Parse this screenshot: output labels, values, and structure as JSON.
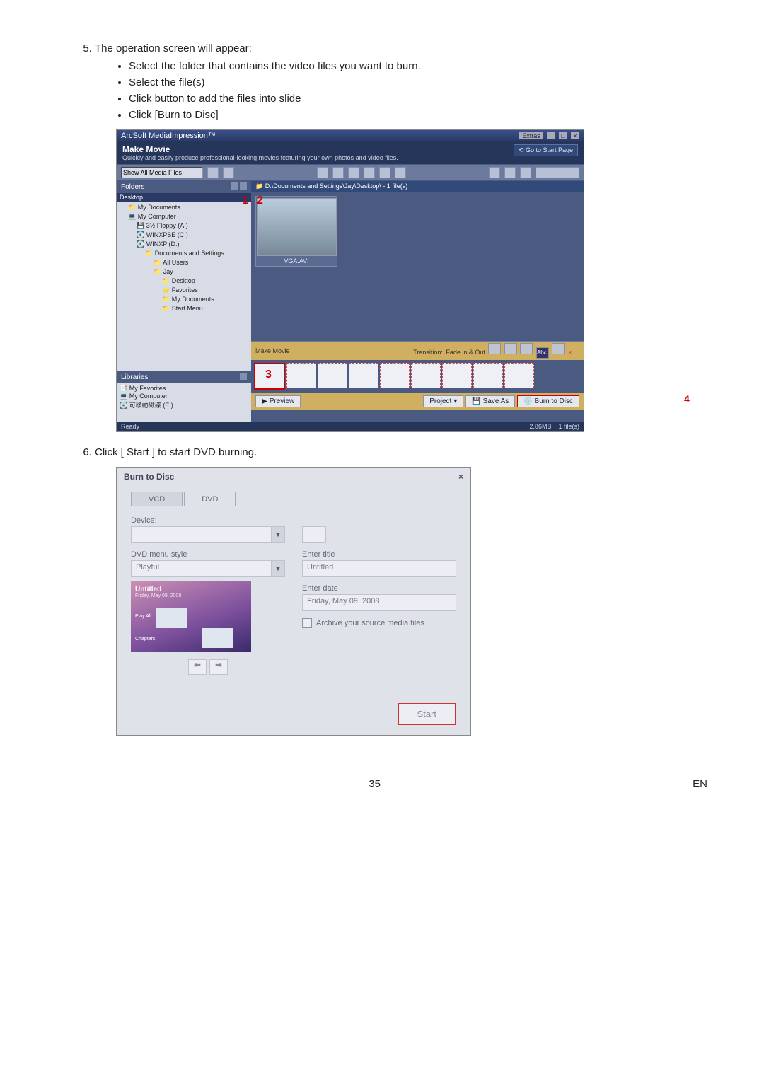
{
  "steps": {
    "s5": {
      "title": "The operation screen will appear:",
      "bullets": [
        "Select the folder that contains the video files you want to burn.",
        "Select the file(s)",
        "Click button to add the files into slide",
        "Click [Burn to Disc]"
      ]
    },
    "s6": {
      "title": "Click [ Start ] to start DVD burning."
    }
  },
  "app1": {
    "title": "ArcSoft MediaImpression™",
    "extras": "Extras",
    "header_title": "Make Movie",
    "header_sub": "Quickly and easily produce professional-looking movies featuring your own photos and video files.",
    "goto": "Go to Start Page",
    "search_value": "Show All Media Files",
    "folders_label": "Folders",
    "tree_top": "Desktop",
    "tree": [
      "My Documents",
      "My Computer",
      "3½ Floppy (A:)",
      "WINXPSE (C:)",
      "WINXP (D:)",
      "Documents and Settings",
      "All Users",
      "Jay",
      "Desktop",
      "Favorites",
      "My Documents",
      "Start Menu"
    ],
    "libraries_label": "Libraries",
    "libs": [
      "My Favorites",
      "My Computer",
      "可移動磁碟 (E:)"
    ],
    "pathbar": "D:\\Documents and Settings\\Jay\\Desktop\\ - 1 file(s)",
    "thumb_caption": "VGA.AVI",
    "storyboard_label": "Make Movie",
    "transition_label": "Transition:",
    "transition_value": "Fade in & Out",
    "preview_btn": "Preview",
    "project_btn": "Project",
    "save_btn": "Save As",
    "burn_btn": "Burn to Disc",
    "status_left": "Ready",
    "status_mid": "2.86MB",
    "status_right": "1 file(s)",
    "marker1": "1",
    "marker2": "2",
    "marker3": "3",
    "marker4": "4"
  },
  "dlg": {
    "title": "Burn to Disc",
    "close": "×",
    "tab_vcd": "VCD",
    "tab_dvd": "DVD",
    "device_label": "Device:",
    "menu_style_label": "DVD menu style",
    "menu_style_value": "Playful",
    "title_label": "Enter title",
    "title_value": "Untitled",
    "date_label": "Enter date",
    "date_value": "Friday, May 09, 2008",
    "archive_label": "Archive your source media files",
    "preview_title": "Untitled",
    "preview_sub": "Friday, May 09, 2008",
    "preview_playall": "Play All",
    "preview_chapters": "Chapters",
    "arrow_prev": "⬅",
    "arrow_next": "➡",
    "start_btn": "Start"
  },
  "footer": {
    "page": "35",
    "lang": "EN"
  }
}
